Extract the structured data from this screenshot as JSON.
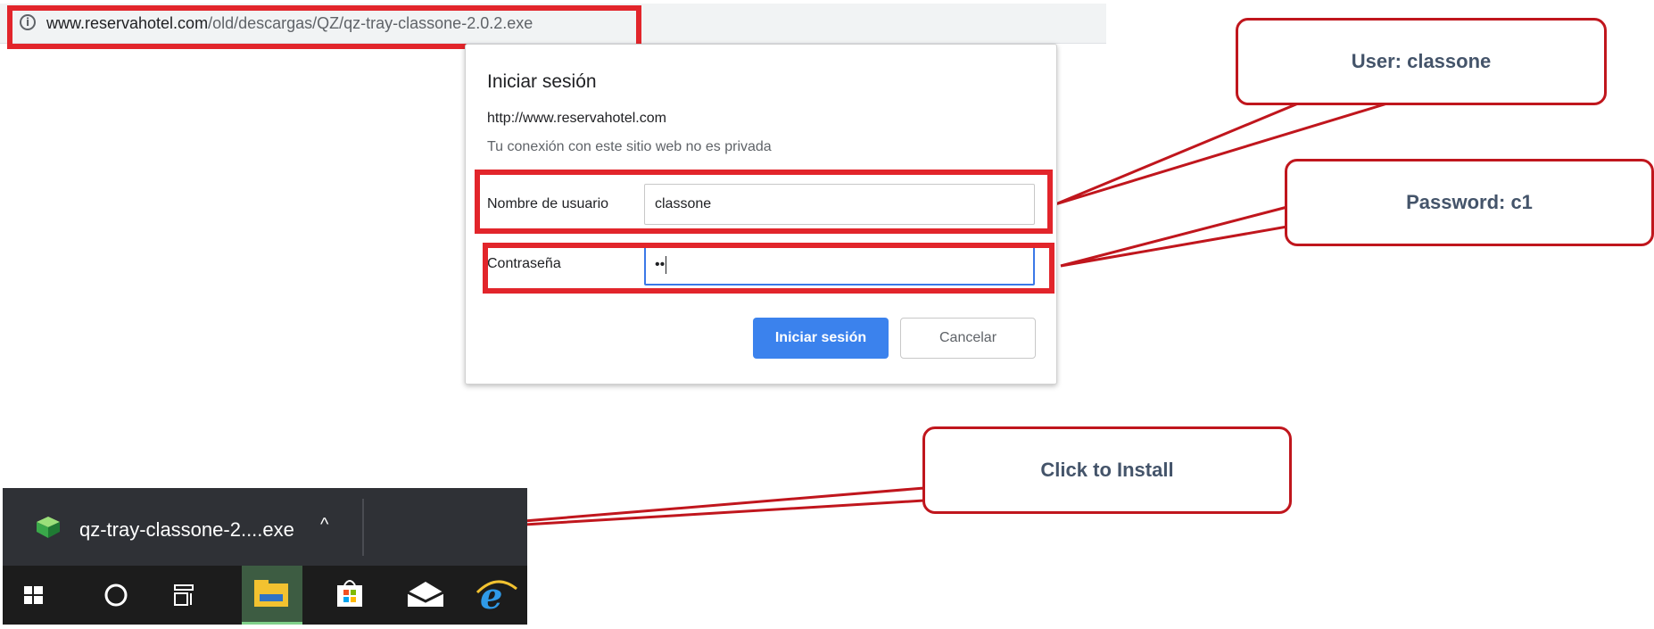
{
  "address_bar": {
    "url_host": "www.reservahotel.com",
    "url_path": "/old/descargas/QZ/qz-tray-classone-2.0.2.exe"
  },
  "dialog": {
    "title": "Iniciar sesión",
    "site": "http://www.reservahotel.com",
    "privacy_note": "Tu conexión con este sitio web no es privada",
    "username_label": "Nombre de usuario",
    "username_value": "classone",
    "password_label": "Contraseña",
    "password_value": "••",
    "login_button": "Iniciar sesión",
    "cancel_button": "Cancelar"
  },
  "callouts": {
    "user": "User: classone",
    "password": "Password: c1",
    "install": "Click to Install"
  },
  "download_bar": {
    "filename": "qz-tray-classone-2....exe",
    "chevron": "^"
  },
  "taskbar": {
    "icons": [
      "windows-start-icon",
      "search-circle-icon",
      "task-view-icon",
      "file-explorer-icon",
      "store-icon",
      "mail-icon",
      "edge-legacy-icon"
    ]
  },
  "colors": {
    "highlight_red": "#e2252b",
    "callout_border": "#c0161d",
    "callout_text": "#44546a",
    "primary_button": "#3b82ed"
  }
}
